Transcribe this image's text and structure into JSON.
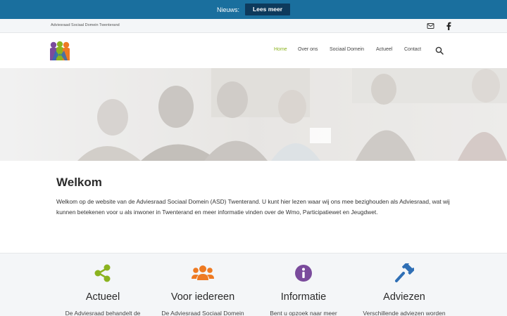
{
  "announcement": {
    "label": "Nieuws:",
    "button": "Lees meer"
  },
  "topbar": {
    "site_name": "Adviesraad Sociaal Domein Twenterand"
  },
  "nav": {
    "items": [
      "Home",
      "Over ons",
      "Sociaal Domein",
      "Actueel",
      "Contact"
    ],
    "active": "Home"
  },
  "welcome": {
    "heading": "Welkom",
    "text": "Welkom op de website van de Adviesraad Sociaal Domein (ASD) Twenterand. U kunt hier  lezen waar wij ons mee bezighouden als Adviesraad, wat wij kunnen betekenen voor u als inwoner in Twenterand en meer informatie vinden over de Wmo, Participatiewet en Jeugdwet."
  },
  "features": [
    {
      "title": "Actueel",
      "text": "De Adviesraad behandelt de",
      "icon": "share-icon",
      "color": "#8bb31f"
    },
    {
      "title": "Voor iedereen",
      "text": "De Adviesraad Sociaal Domein",
      "icon": "users-icon",
      "color": "#ee7a22"
    },
    {
      "title": "Informatie",
      "text": "Bent u opzoek naar meer",
      "icon": "info-icon",
      "color": "#7a4b9c"
    },
    {
      "title": "Adviezen",
      "text": "Verschillende adviezen worden",
      "icon": "gavel-icon",
      "color": "#2f6fb5"
    }
  ],
  "colors": {
    "topbar": "#1a6f9e",
    "button": "#0e3a5c",
    "nav_active": "#8bb31f"
  }
}
